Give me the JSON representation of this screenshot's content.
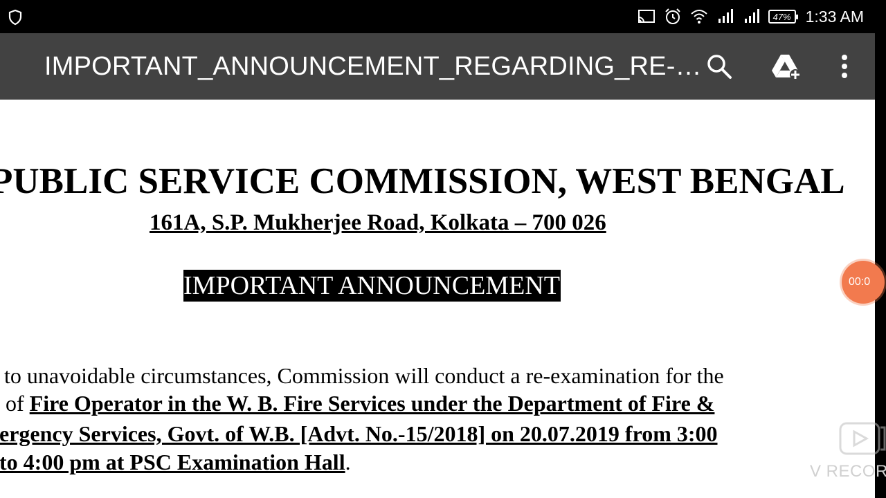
{
  "status_bar": {
    "time": "1:33 AM",
    "battery_percent": "47%",
    "icons": [
      "shield-icon",
      "cast-icon",
      "alarm-icon",
      "wifi-icon",
      "signal-icon",
      "signal-icon",
      "battery-icon"
    ]
  },
  "toolbar": {
    "title": "IMPORTANT_ANNOUNCEMENT_REGARDING_RE-…",
    "actions": [
      "search-icon",
      "drive-add-icon",
      "more-vert-icon"
    ]
  },
  "document": {
    "organization": "PUBLIC SERVICE COMMISSION, WEST BENGAL",
    "address": "161A, S.P. Mukherjee Road, Kolkata – 700 026",
    "heading": "IMPORTANT ANNOUNCEMENT",
    "line1": "to unavoidable circumstances, Commission will conduct a re-examination for the",
    "line2_prefix": "of ",
    "line2_bold": "Fire Operator in the W. B. Fire Services under the Department of Fire &",
    "line3_bold": "ergency Services, Govt. of W.B. [Advt. No.-15/2018] on 20.07.2019 from 3:00",
    "line4_bold": "to 4:00 pm at PSC Examination Hall",
    "line4_suffix": "."
  },
  "overlay": {
    "recorder_timer": "00:0",
    "recorder_watermark": "V RECOR"
  },
  "colors": {
    "status_bar": "#000000",
    "toolbar": "#424242",
    "recorder_accent": "#f27a4e"
  }
}
